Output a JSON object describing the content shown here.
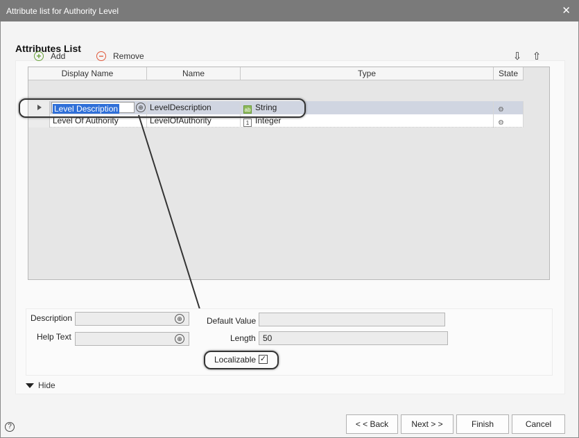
{
  "window": {
    "title": "Attribute list for Authority Level",
    "close_glyph": "✕"
  },
  "section": {
    "title": "Attributes List"
  },
  "toolbar": {
    "add_label": "Add",
    "remove_label": "Remove",
    "add_icon": "+",
    "remove_icon": "−",
    "move_down_glyph": "⇩",
    "move_up_glyph": "⇧"
  },
  "grid": {
    "columns": [
      "Display Name",
      "Name",
      "Type",
      "State"
    ],
    "rows": [
      {
        "display_name": "Level Description",
        "name": "LevelDescription",
        "type": "String",
        "type_icon": "ab"
      },
      {
        "display_name": "Level Of Authority",
        "name": "LevelOfAuthority",
        "type": "Integer",
        "type_icon": "1"
      }
    ]
  },
  "props": {
    "description_label": "Description",
    "help_text_label": "Help Text",
    "default_value_label": "Default Value",
    "length_label": "Length",
    "length_value": "50",
    "localizable_label": "Localizable",
    "localizable_checked": "✓"
  },
  "hide_label": "Hide",
  "help_glyph": "?",
  "footer": {
    "back": "< < Back",
    "next": "Next > >",
    "finish": "Finish",
    "cancel": "Cancel"
  },
  "colors": {
    "titlebar": "#7a7a7a",
    "selected_row": "#d0d5e1",
    "selection": "#2f6fd8"
  }
}
